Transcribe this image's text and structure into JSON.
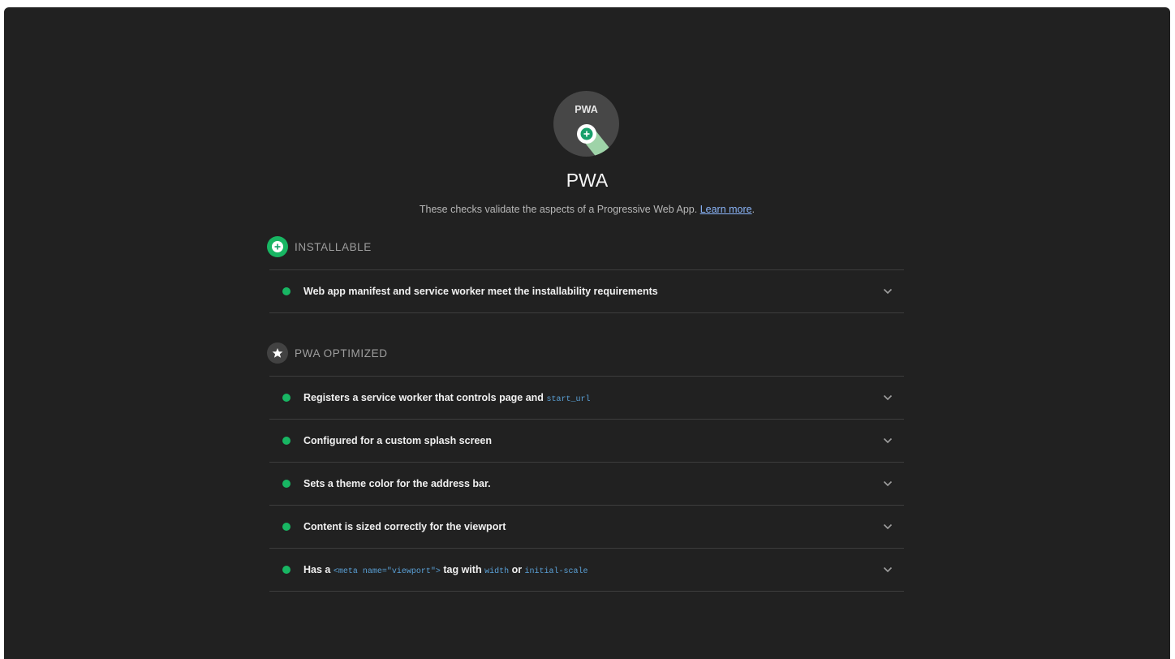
{
  "category": {
    "title": "PWA",
    "gauge_text": "PWA",
    "description": "These checks validate the aspects of a Progressive Web App.",
    "learn_more": "Learn more",
    "learn_more_suffix": "."
  },
  "groups": {
    "installable": {
      "label": "INSTALLABLE",
      "icon": "plus-icon",
      "color": "#18b663",
      "audits": [
        {
          "text": "Web app manifest and service worker meet the installability requirements",
          "status": "pass"
        }
      ]
    },
    "optimized": {
      "label": "PWA OPTIMIZED",
      "icon": "star-icon",
      "color": "#424242",
      "audits": [
        {
          "text": "Registers a service worker that controls page and",
          "code": "start_url",
          "status": "pass"
        },
        {
          "text": "Configured for a custom splash screen",
          "status": "pass"
        },
        {
          "text": "Sets a theme color for the address bar.",
          "status": "pass"
        },
        {
          "text": "Content is sized correctly for the viewport",
          "status": "pass"
        },
        {
          "text_1": "Has a",
          "code_1": "<meta name=\"viewport\">",
          "text_2": "tag with",
          "code_2": "width",
          "text_3": "or",
          "code_3": "initial-scale",
          "status": "pass"
        }
      ]
    }
  },
  "colors": {
    "background": "#212121",
    "pass": "#18b663",
    "link": "#8ab4f8",
    "code": "#5aa0d6"
  }
}
